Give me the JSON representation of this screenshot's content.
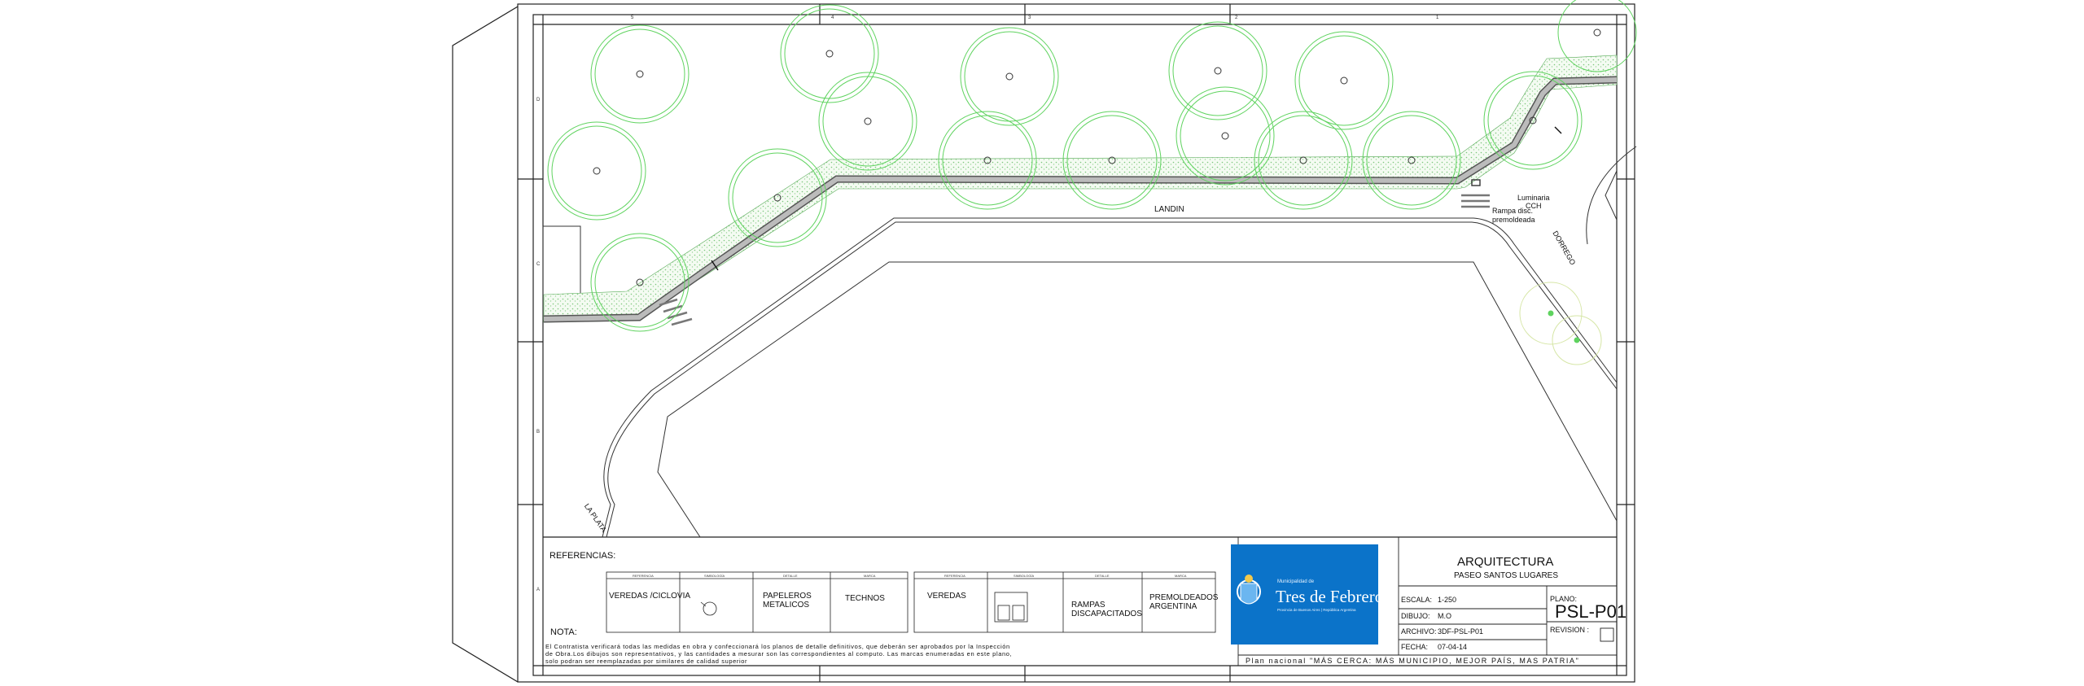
{
  "drawing": {
    "streets": {
      "landin": "LANDIN",
      "dorrego": "DORREGO",
      "la_plata": "LA PLATA"
    },
    "annotations": {
      "luminaria_line1": "Luminaria",
      "luminaria_line2": "CCH",
      "rampa_line1": "Rampa disc.",
      "rampa_line2": "premoldeada"
    },
    "grid_columns": [
      "5",
      "4",
      "3",
      "2",
      "1"
    ],
    "grid_rows": [
      "D",
      "C",
      "B",
      "A"
    ]
  },
  "references": {
    "title": "REFERENCIAS:",
    "nota_label": "NOTA:",
    "table1": {
      "headers": [
        "REFERENCIA",
        "SIMBOLOGÍA",
        "DETALLE",
        "MARCA"
      ],
      "row": [
        "VEREDAS /CICLOVIA",
        "",
        "PAPELEROS METALICOS",
        "TECHNOS"
      ]
    },
    "table2": {
      "headers": [
        "REFERENCIA",
        "SIMBOLOGÍA",
        "DETALLE",
        "MARCA"
      ],
      "row": [
        "VEREDAS",
        "",
        "RAMPAS DISCAPACITADOS",
        "PREMOLDEADOS ARGENTINA"
      ]
    },
    "note_text_1": "El Contratista verificará todas las medidas en obra y confeccionará los planos de detalle definitivos, que deberán ser aprobados por la Inspección",
    "note_text_2": "de Obra.Los dibujos son representativos, y las cantidades a mesurar son las correspondientes al computo. Las marcas enumeradas en este plano,",
    "note_text_3": "solo podran ser reemplazadas por similares de calidad superior"
  },
  "logo": {
    "small": "Municipalidad de",
    "main": "Tres de Febrero",
    "sub": "Provincia de Buenos Aires | República Argentina",
    "bg_color": "#0b73c9"
  },
  "title_block": {
    "title": "ARQUITECTURA",
    "subtitle": "PASEO SANTOS LUGARES",
    "escala_label": "ESCALA:",
    "escala_value": "1-250",
    "dibujo_label": "DIBUJO:",
    "dibujo_value": "M.O",
    "archivo_label": "ARCHIVO:",
    "archivo_value": "3DF-PSL-P01",
    "fecha_label": "FECHA:",
    "fecha_value": "07-04-14",
    "plano_label": "PLANO:",
    "plano_value": "PSL-P01",
    "revision_label": "REVISION :",
    "slogan": "Plan nacional \"MÁS CERCA: MÁS MUNICIPIO, MEJOR PAÍS, MAS PATRIA\""
  },
  "colors": {
    "tree_green": "#5fd35f",
    "hatch": "#6cbf6c",
    "line": "#111111"
  }
}
